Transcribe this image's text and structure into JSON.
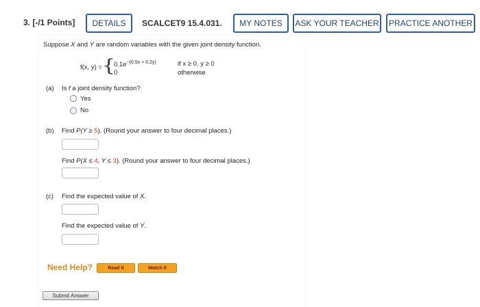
{
  "header": {
    "question_number": "3.  [-/1 Points]",
    "details_label": "DETAILS",
    "code": "SCALCET9 15.4.031.",
    "my_notes_label": "MY NOTES",
    "ask_teacher_label": "ASK YOUR TEACHER",
    "practice_label": "PRACTICE ANOTHER"
  },
  "problem": {
    "intro_1": "Suppose ",
    "var_x": "X",
    "intro_2": " and ",
    "var_y": "Y",
    "intro_3": " are random variables with the given joint density function.",
    "f_lhs": "f(x, y) =",
    "case1_expr": "0.1e",
    "case1_exp": "−(0.5x + 0.2y)",
    "case1_cond": "if x ≥ 0, y ≥ 0",
    "case2_expr": "0",
    "case2_cond": "otherwise"
  },
  "part_a": {
    "label": "(a)",
    "question_pre": "Is ",
    "question_f": "f",
    "question_post": " a joint density function?",
    "options": [
      "Yes",
      "No"
    ]
  },
  "part_b": {
    "label": "(b)",
    "q1_pre": "Find ",
    "q1_prob": "P(Y ≥ ",
    "q1_val": "5",
    "q1_post": "). (Round your answer to four decimal places.)",
    "q2_pre": "Find ",
    "q2_prob_a": "P(X ≤ ",
    "q2_val_a": "4",
    "q2_mid": ", Y ≤ ",
    "q2_val_b": "3",
    "q2_post": "). (Round your answer to four decimal places.)"
  },
  "part_c": {
    "label": "(c)",
    "q1_pre": "Find the expected value of ",
    "q1_var": "X",
    "q1_post": ".",
    "q2_pre": "Find the expected value of ",
    "q2_var": "Y",
    "q2_post": "."
  },
  "help": {
    "label": "Need Help?",
    "read_it": "Read It",
    "watch_it": "Watch It"
  },
  "submit_label": "Submit Answer",
  "colors": {
    "accent": "#2a5db0",
    "highlight": "#d83b2b",
    "help_orange": "#f4a21f"
  }
}
